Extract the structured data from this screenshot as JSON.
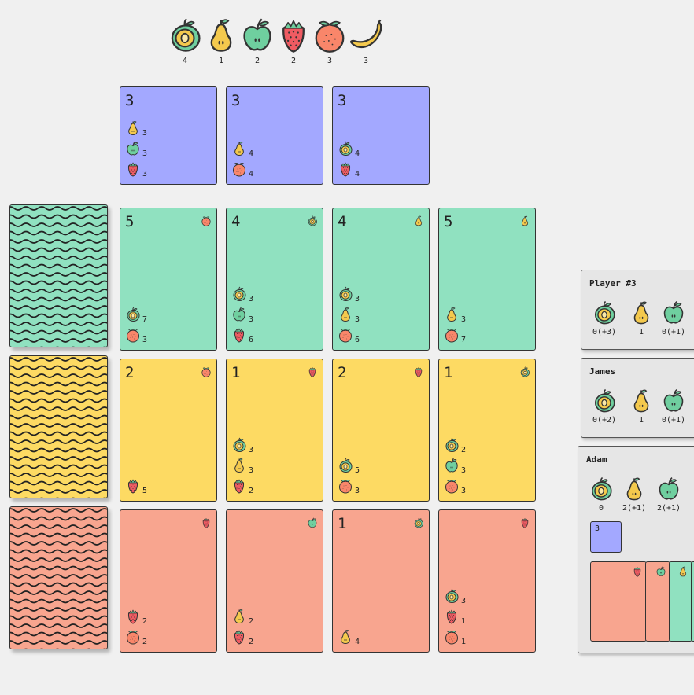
{
  "bank": [
    {
      "fruit": "lime",
      "count": "4"
    },
    {
      "fruit": "pear",
      "count": "1"
    },
    {
      "fruit": "apple",
      "count": "2"
    },
    {
      "fruit": "strawberry",
      "count": "2"
    },
    {
      "fruit": "orange",
      "count": "3"
    },
    {
      "fruit": "banana",
      "count": "3"
    }
  ],
  "nobles": [
    {
      "points": "3",
      "costs": [
        {
          "fruit": "pear",
          "n": "3"
        },
        {
          "fruit": "apple",
          "n": "3"
        },
        {
          "fruit": "strawberry",
          "n": "3"
        }
      ]
    },
    {
      "points": "3",
      "costs": [
        {
          "fruit": "pear",
          "n": "4"
        },
        {
          "fruit": "orange",
          "n": "4"
        }
      ]
    },
    {
      "points": "3",
      "costs": [
        {
          "fruit": "lime",
          "n": "4"
        },
        {
          "fruit": "strawberry",
          "n": "4"
        }
      ]
    }
  ],
  "rows": [
    {
      "tier": "green",
      "cards": [
        {
          "points": "5",
          "gem": "orange",
          "costs": [
            {
              "fruit": "lime",
              "n": "7"
            },
            {
              "fruit": "orange",
              "n": "3"
            }
          ]
        },
        {
          "points": "4",
          "gem": "lime",
          "costs": [
            {
              "fruit": "lime",
              "n": "3"
            },
            {
              "fruit": "apple",
              "n": "3"
            },
            {
              "fruit": "strawberry",
              "n": "6"
            }
          ]
        },
        {
          "points": "4",
          "gem": "pear",
          "costs": [
            {
              "fruit": "lime",
              "n": "3"
            },
            {
              "fruit": "pear",
              "n": "3"
            },
            {
              "fruit": "orange",
              "n": "6"
            }
          ]
        },
        {
          "points": "5",
          "gem": "pear",
          "costs": [
            {
              "fruit": "pear",
              "n": "3"
            },
            {
              "fruit": "orange",
              "n": "7"
            }
          ]
        }
      ]
    },
    {
      "tier": "yellow",
      "cards": [
        {
          "points": "2",
          "gem": "orange",
          "costs": [
            {
              "fruit": "strawberry",
              "n": "5"
            }
          ]
        },
        {
          "points": "1",
          "gem": "strawberry",
          "costs": [
            {
              "fruit": "lime",
              "n": "3"
            },
            {
              "fruit": "pear",
              "n": "3"
            },
            {
              "fruit": "strawberry",
              "n": "2"
            }
          ]
        },
        {
          "points": "2",
          "gem": "strawberry",
          "costs": [
            {
              "fruit": "lime",
              "n": "5"
            },
            {
              "fruit": "orange",
              "n": "3"
            }
          ]
        },
        {
          "points": "1",
          "gem": "lime",
          "costs": [
            {
              "fruit": "lime",
              "n": "2"
            },
            {
              "fruit": "apple",
              "n": "3"
            },
            {
              "fruit": "orange",
              "n": "3"
            }
          ]
        }
      ]
    },
    {
      "tier": "red",
      "cards": [
        {
          "points": "",
          "gem": "strawberry",
          "costs": [
            {
              "fruit": "strawberry",
              "n": "2"
            },
            {
              "fruit": "orange",
              "n": "2"
            }
          ]
        },
        {
          "points": "",
          "gem": "apple",
          "costs": [
            {
              "fruit": "pear",
              "n": "2"
            },
            {
              "fruit": "strawberry",
              "n": "2"
            }
          ]
        },
        {
          "points": "1",
          "gem": "lime",
          "costs": [
            {
              "fruit": "pear",
              "n": "4"
            }
          ]
        },
        {
          "points": "",
          "gem": "strawberry",
          "costs": [
            {
              "fruit": "lime",
              "n": "3"
            },
            {
              "fruit": "strawberry",
              "n": "1"
            },
            {
              "fruit": "orange",
              "n": "1"
            }
          ]
        }
      ]
    }
  ],
  "players": [
    {
      "name": "Player #3",
      "stats": [
        {
          "fruit": "lime",
          "value": "0(+3)"
        },
        {
          "fruit": "pear",
          "value": "1"
        },
        {
          "fruit": "apple",
          "value": "0(+1)"
        }
      ]
    },
    {
      "name": "James",
      "stats": [
        {
          "fruit": "lime",
          "value": "0(+2)"
        },
        {
          "fruit": "pear",
          "value": "1"
        },
        {
          "fruit": "apple",
          "value": "0(+1)"
        }
      ]
    },
    {
      "name": "Adam",
      "stats": [
        {
          "fruit": "lime",
          "value": "0"
        },
        {
          "fruit": "pear",
          "value": "2(+1)"
        },
        {
          "fruit": "apple",
          "value": "2(+1)"
        }
      ],
      "reserved_noble_points": "3",
      "owned_cards": [
        {
          "tier": "red",
          "gem": "strawberry"
        },
        {
          "tier": "red",
          "gem": "apple"
        },
        {
          "tier": "green",
          "gem": "pear"
        }
      ]
    }
  ],
  "colors": {
    "blue": "#a3a8ff",
    "green": "#90e1c0",
    "yellow": "#fdda63",
    "red": "#f8a58f"
  }
}
